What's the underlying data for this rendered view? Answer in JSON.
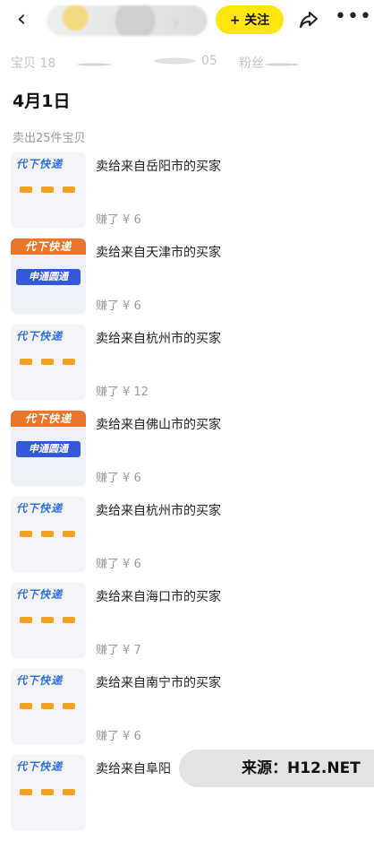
{
  "header": {
    "back_label": "‹",
    "shop_name_tail": "y",
    "follow_label": "+ 关注",
    "more_label": "•••"
  },
  "stats": {
    "items_label": "宝贝 18",
    "value_mid": "05",
    "label_right": "粉丝"
  },
  "section": {
    "date": "4月1日",
    "sold_count": "卖出25件宝贝"
  },
  "thumb_texts": {
    "top": "代下快递",
    "banner": "申通圆通"
  },
  "items": [
    {
      "title": "卖给来自岳阳市的买家",
      "earn": "赚了 ¥ 6",
      "thumb": "a"
    },
    {
      "title": "卖给来自天津市的买家",
      "earn": "赚了 ¥ 6",
      "thumb": "b"
    },
    {
      "title": "卖给来自杭州市的买家",
      "earn": "赚了 ¥ 12",
      "thumb": "a"
    },
    {
      "title": "卖给来自佛山市的买家",
      "earn": "赚了 ¥ 6",
      "thumb": "b"
    },
    {
      "title": "卖给来自杭州市的买家",
      "earn": "赚了 ¥ 6",
      "thumb": "a"
    },
    {
      "title": "卖给来自海口市的买家",
      "earn": "赚了 ¥ 7",
      "thumb": "a"
    },
    {
      "title": "卖给来自南宁市的买家",
      "earn": "赚了 ¥ 6",
      "thumb": "a"
    },
    {
      "title": "卖给来自阜阳",
      "earn": "",
      "thumb": "a"
    }
  ],
  "watermark": "来源：H12.NET",
  "colors": {
    "follow_bg": "#ffe60f",
    "muted_text": "#9a9a9a",
    "thumb_blue": "#2f6fe0",
    "thumb_orange": "#e9762a",
    "dot_yellow": "#f2a21f"
  }
}
